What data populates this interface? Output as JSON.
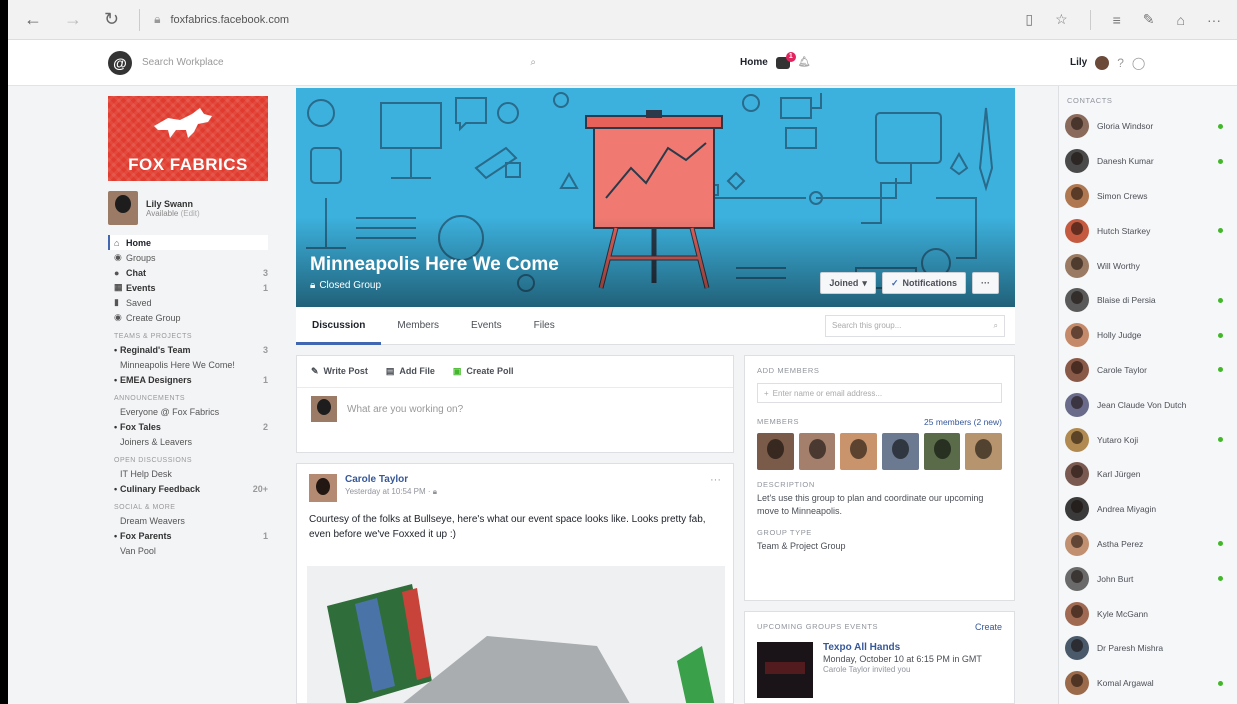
{
  "browser": {
    "url": "foxfabrics.facebook.com"
  },
  "topbar": {
    "search_placeholder": "Search Workplace",
    "home_label": "Home",
    "notif_count": "1",
    "user_name": "Lily"
  },
  "sidebar": {
    "brand_text": "FOX FABRICS",
    "profile_name": "Lily Swann",
    "profile_status": "Available",
    "profile_edit": "(Edit)",
    "nav": [
      {
        "label": "Home",
        "count": ""
      },
      {
        "label": "Groups",
        "count": ""
      },
      {
        "label": "Chat",
        "count": "3"
      },
      {
        "label": "Events",
        "count": "1"
      },
      {
        "label": "Saved",
        "count": ""
      },
      {
        "label": "Create Group",
        "count": ""
      }
    ],
    "sections": [
      {
        "title": "TEAMS & PROJECTS",
        "items": [
          {
            "label": "Reginald's Team",
            "count": "3",
            "bold": true
          },
          {
            "label": "Minneapolis Here We Come!",
            "count": "",
            "bold": false
          },
          {
            "label": "EMEA Designers",
            "count": "1",
            "bold": true
          }
        ]
      },
      {
        "title": "ANNOUNCEMENTS",
        "items": [
          {
            "label": "Everyone @ Fox Fabrics",
            "count": "",
            "bold": false
          },
          {
            "label": "Fox Tales",
            "count": "2",
            "bold": true
          },
          {
            "label": "Joiners & Leavers",
            "count": "",
            "bold": false
          }
        ]
      },
      {
        "title": "OPEN DISCUSSIONS",
        "items": [
          {
            "label": "IT Help Desk",
            "count": "",
            "bold": false
          },
          {
            "label": "Culinary Feedback",
            "count": "20+",
            "bold": true
          }
        ]
      },
      {
        "title": "SOCIAL & MORE",
        "items": [
          {
            "label": "Dream Weavers",
            "count": "",
            "bold": false
          },
          {
            "label": "Fox Parents",
            "count": "1",
            "bold": true
          },
          {
            "label": "Van Pool",
            "count": "",
            "bold": false
          }
        ]
      }
    ]
  },
  "group": {
    "title": "Minneapolis Here We Come",
    "privacy": "Closed Group",
    "joined_label": "Joined",
    "notifications_label": "Notifications",
    "more_label": "···",
    "tabs": [
      "Discussion",
      "Members",
      "Events",
      "Files"
    ],
    "search_placeholder": "Search this group..."
  },
  "composer": {
    "write_post": "Write Post",
    "add_file": "Add File",
    "create_poll": "Create Poll",
    "placeholder": "What are you working on?"
  },
  "post": {
    "author": "Carole Taylor",
    "time": "Yesterday at 10:54 PM",
    "text": "Courtesy of the folks at Bullseye, here's what our event space looks like. Looks pretty fab, even before we've Foxxed it up :)"
  },
  "info": {
    "add_members_label": "ADD MEMBERS",
    "add_members_placeholder": "Enter name or email address...",
    "members_label": "MEMBERS",
    "members_count": "25 members (2 new)",
    "description_label": "DESCRIPTION",
    "description": "Let's use this group to plan and coordinate our upcoming move to Minneapolis.",
    "group_type_label": "GROUP TYPE",
    "group_type": "Team & Project Group",
    "member_colors": [
      "#7a5a48",
      "#a37f6c",
      "#c9946c",
      "#6b7a90",
      "#5a6b4a",
      "#b6946e"
    ]
  },
  "events": {
    "label": "UPCOMING GROUPS EVENTS",
    "create_label": "Create",
    "title": "Texpo All Hands",
    "when": "Monday, October 10 at 6:15 PM in GMT",
    "invited": "Carole Taylor invited you"
  },
  "contacts": {
    "label": "CONTACTS",
    "people": [
      {
        "name": "Gloria Windsor",
        "online": true,
        "color": "#8a6a5a"
      },
      {
        "name": "Danesh Kumar",
        "online": true,
        "color": "#4a4a4a"
      },
      {
        "name": "Simon Crews",
        "online": false,
        "color": "#b07850"
      },
      {
        "name": "Hutch Starkey",
        "online": true,
        "color": "#c45a40"
      },
      {
        "name": "Will Worthy",
        "online": false,
        "color": "#9a7a62"
      },
      {
        "name": "Blaise di Persia",
        "online": true,
        "color": "#5a5a5a"
      },
      {
        "name": "Holly Judge",
        "online": true,
        "color": "#c48a6a"
      },
      {
        "name": "Carole Taylor",
        "online": true,
        "color": "#8a5a48"
      },
      {
        "name": "Jean Claude Von Dutch",
        "online": false,
        "color": "#6a6a8a"
      },
      {
        "name": "Yutaro Koji",
        "online": true,
        "color": "#b08a50"
      },
      {
        "name": "Karl Jürgen",
        "online": false,
        "color": "#7a5a50"
      },
      {
        "name": "Andrea Miyagin",
        "online": false,
        "color": "#3a3a3a"
      },
      {
        "name": "Astha Perez",
        "online": true,
        "color": "#c09070"
      },
      {
        "name": "John Burt",
        "online": true,
        "color": "#6a6a6a"
      },
      {
        "name": "Kyle McGann",
        "online": false,
        "color": "#a06a52"
      },
      {
        "name": "Dr Paresh Mishra",
        "online": false,
        "color": "#4a5a6a"
      },
      {
        "name": "Komal Argawal",
        "online": true,
        "color": "#9a6a4a"
      }
    ]
  }
}
